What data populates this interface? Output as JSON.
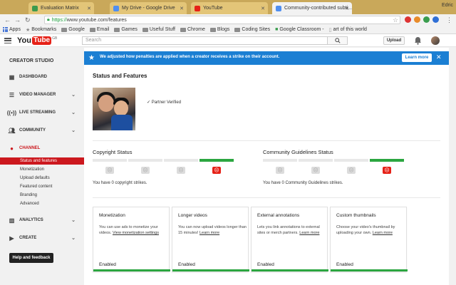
{
  "browser": {
    "tabs": [
      {
        "label": "Evaluation Matrix",
        "fav_color": "#3c9a4d",
        "active": false
      },
      {
        "label": "My Drive - Google Drive",
        "fav_color": "#4f8ef0",
        "active": false
      },
      {
        "label": "YouTube",
        "fav_color": "#e62117",
        "active": false
      },
      {
        "label": "Community-contributed subti...",
        "fav_color": "#4f8ef0",
        "active": true
      }
    ],
    "user": "Edric",
    "url_scheme": "https://",
    "url_rest": "www.youtube.com/features",
    "bookmarks": {
      "apps": "Apps",
      "items": [
        "Bookmarks",
        "Google",
        "Email",
        "Games",
        "Useful Stuff",
        "Chrome",
        "Blogs",
        "Coding Sites",
        "Google Classroom -",
        "art of this world"
      ]
    }
  },
  "header": {
    "logo_you": "You",
    "logo_tube": "Tube",
    "logo_region": "GB",
    "search_placeholder": "Search",
    "upload_label": "Upload"
  },
  "sidebar": {
    "title": "CREATOR STUDIO",
    "items": [
      {
        "label": "DASHBOARD",
        "icon": "dashboard-icon"
      },
      {
        "label": "VIDEO MANAGER",
        "icon": "video-manager-icon"
      },
      {
        "label": "LIVE STREAMING",
        "icon": "live-icon"
      },
      {
        "label": "COMMUNITY",
        "icon": "community-icon"
      },
      {
        "label": "CHANNEL",
        "icon": "channel-icon"
      }
    ],
    "channel_sub": [
      "Status and features",
      "Monetization",
      "Upload defaults",
      "Featured content",
      "Branding",
      "Advanced"
    ],
    "more": [
      {
        "label": "ANALYTICS",
        "icon": "analytics-icon"
      },
      {
        "label": "CREATE",
        "icon": "create-icon"
      }
    ],
    "help_label": "Help and feedback",
    "accent": "#cc181e"
  },
  "banner": {
    "message": "We adjusted how penalties are applied when a creator receives a strike on their account.",
    "learn_more": "Learn more",
    "color": "#1b7fd3"
  },
  "main": {
    "title": "Status and Features",
    "partner": "Partner Verified",
    "copyright": {
      "title": "Copyright Status",
      "text": "You have 0 copyright strikes.",
      "active_level": 4
    },
    "community": {
      "title": "Community Guidelines Status",
      "text": "You have 0 Community Guidelines strikes.",
      "active_level": 4
    },
    "cards": [
      {
        "title": "Monetization",
        "body": "You can use ads to monetize your videos. ",
        "link": "View monetization settings",
        "status": "Enabled"
      },
      {
        "title": "Longer videos",
        "body": "You can now upload videos longer than 15 minutes! ",
        "link": "Learn more",
        "status": "Enabled"
      },
      {
        "title": "External annotations",
        "body": "Lets you link annotations to external sites or merch partners. ",
        "link": "Learn more",
        "status": "Enabled"
      },
      {
        "title": "Custom thumbnails",
        "body": "Choose your video's thumbnail by uploading your own. ",
        "link": "Learn more",
        "status": "Enabled"
      }
    ]
  }
}
